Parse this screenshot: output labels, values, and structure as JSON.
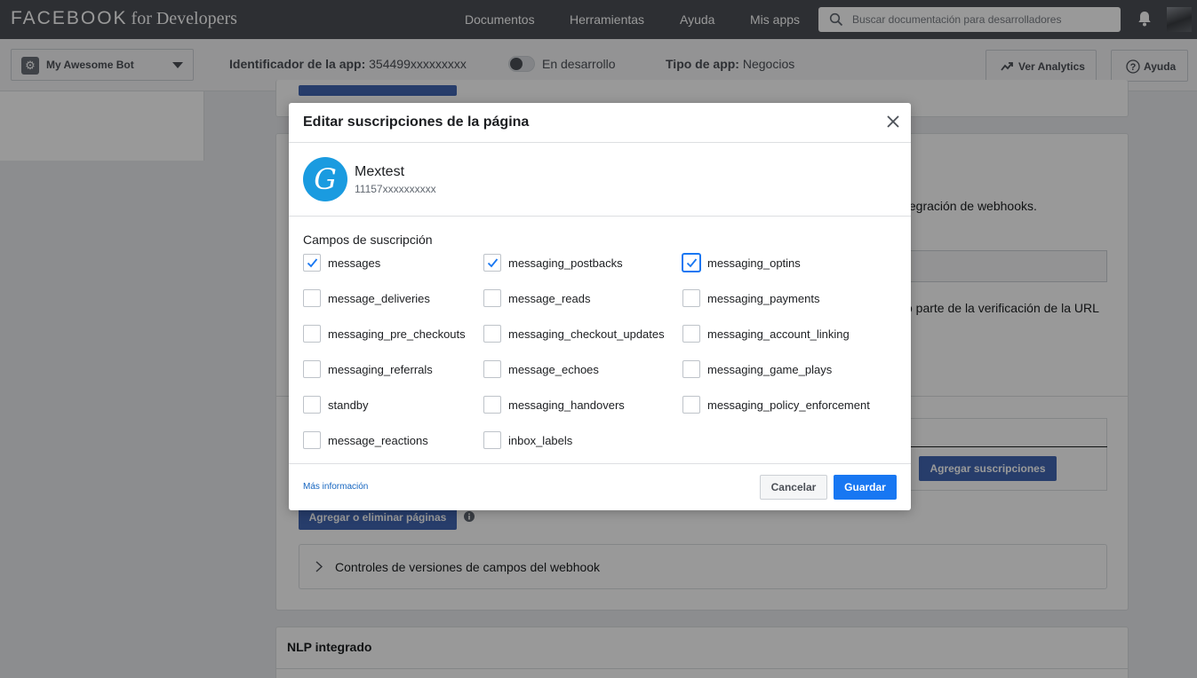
{
  "topbar": {
    "brand_main": "FACEBOOK",
    "brand_sub": "for Developers",
    "nav": [
      "Documentos",
      "Herramientas",
      "Ayuda",
      "Mis apps"
    ],
    "search_placeholder": "Buscar documentación para desarrolladores"
  },
  "appbar": {
    "app_name": "My Awesome Bot",
    "app_id_label": "Identificador de la app:",
    "app_id_value": "354499xxxxxxxxx",
    "mode_label": "En desarrollo",
    "type_label": "Tipo de app:",
    "type_value": "Negocios",
    "analytics_label": "Ver Analytics",
    "help_label": "Ayuda"
  },
  "background": {
    "webhooks_text_tail": "tegración de webhooks.",
    "verify_text_tail": "o parte de la verificación de la URL",
    "add_subscriptions": "Agregar suscripciones",
    "add_remove_pages": "Agregar o eliminar páginas",
    "version_controls": "Controles de versiones de campos del webhook",
    "nlp_title": "NLP integrado"
  },
  "dialog": {
    "title": "Editar suscripciones de la página",
    "page_initial": "G",
    "page_name": "Mextest",
    "page_id": "11157xxxxxxxxxx",
    "fields_label": "Campos de suscripción",
    "columns": [
      [
        {
          "label": "messages",
          "checked": true
        },
        {
          "label": "message_deliveries",
          "checked": false
        },
        {
          "label": "messaging_pre_checkouts",
          "checked": false
        },
        {
          "label": "messaging_referrals",
          "checked": false
        },
        {
          "label": "standby",
          "checked": false
        },
        {
          "label": "message_reactions",
          "checked": false
        }
      ],
      [
        {
          "label": "messaging_postbacks",
          "checked": true
        },
        {
          "label": "message_reads",
          "checked": false
        },
        {
          "label": "messaging_checkout_updates",
          "checked": false
        },
        {
          "label": "message_echoes",
          "checked": false
        },
        {
          "label": "messaging_handovers",
          "checked": false
        },
        {
          "label": "inbox_labels",
          "checked": false
        }
      ],
      [
        {
          "label": "messaging_optins",
          "checked": true
        },
        {
          "label": "messaging_payments",
          "checked": false
        },
        {
          "label": "messaging_account_linking",
          "checked": false
        },
        {
          "label": "messaging_game_plays",
          "checked": false
        },
        {
          "label": "messaging_policy_enforcement",
          "checked": false
        }
      ]
    ],
    "more_info": "Más información",
    "cancel": "Cancelar",
    "save": "Guardar"
  },
  "colors": {
    "topbar_bg": "#4b4f56",
    "primary_button": "#1877f2",
    "page_logo": "#1a9be0",
    "link": "#1565c0"
  }
}
